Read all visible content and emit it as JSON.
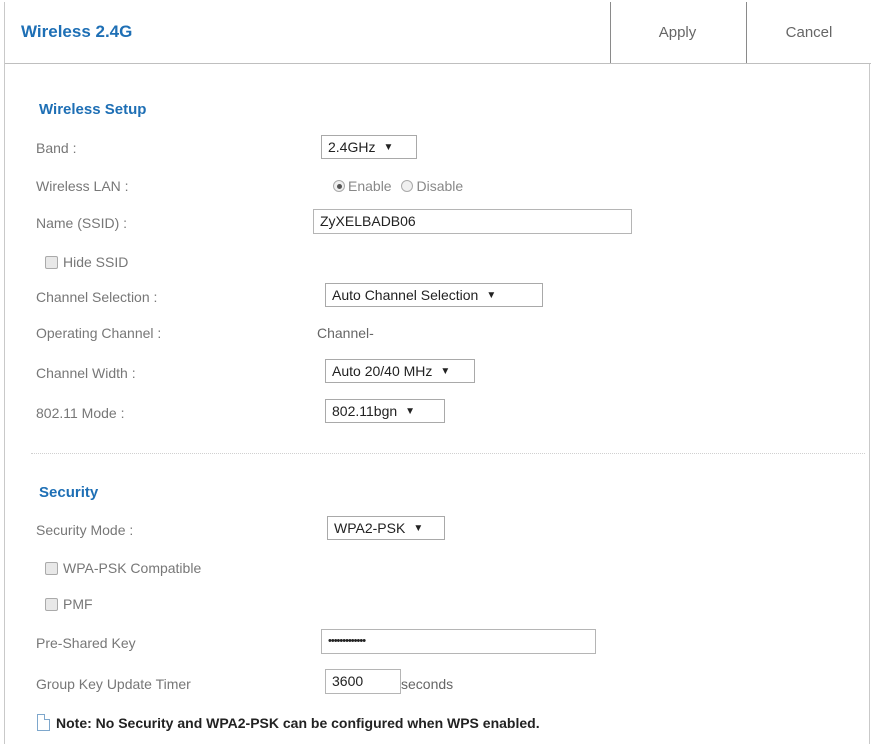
{
  "header": {
    "title": "Wireless 2.4G",
    "apply_label": "Apply",
    "cancel_label": "Cancel"
  },
  "wireless_setup": {
    "title": "Wireless Setup",
    "band_label": "Band :",
    "band_value": "2.4GHz",
    "wireless_lan_label": "Wireless LAN :",
    "enable_label": "Enable",
    "disable_label": "Disable",
    "ssid_label": "Name (SSID) :",
    "ssid_value": "ZyXELBADB06",
    "hide_ssid_label": "Hide SSID",
    "channel_selection_label": "Channel Selection :",
    "channel_selection_value": "Auto Channel Selection",
    "operating_channel_label": "Operating Channel :",
    "operating_channel_value": "Channel-",
    "channel_width_label": "Channel Width :",
    "channel_width_value": "Auto 20/40 MHz",
    "mode_label": "802.11 Mode :",
    "mode_value": "802.11bgn"
  },
  "security": {
    "title": "Security",
    "mode_label": "Security Mode :",
    "mode_value": "WPA2-PSK",
    "wpa_compat_label": "WPA-PSK Compatible",
    "pmf_label": "PMF",
    "psk_label": "Pre-Shared Key",
    "psk_value": "•••••••••••••",
    "timer_label": "Group Key Update Timer",
    "timer_value": "3600",
    "timer_unit": "seconds"
  },
  "note": "Note: No Security and WPA2-PSK can be configured when WPS enabled.",
  "colors": {
    "accent": "#1e6fb5"
  }
}
